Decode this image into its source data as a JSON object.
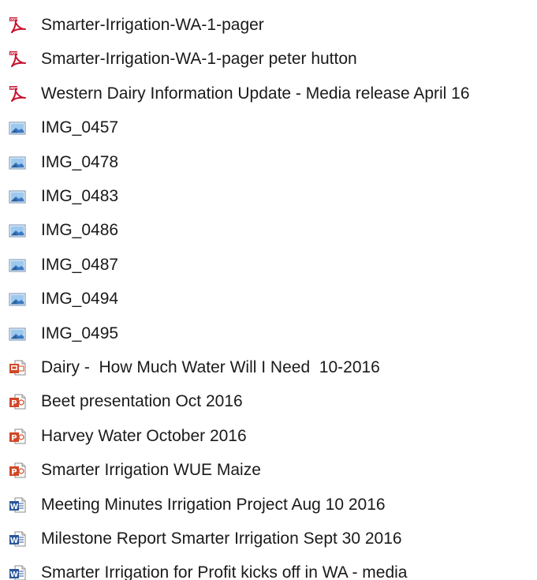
{
  "files": [
    {
      "name": "Smarter-Irrigation-WA-1-pager",
      "type": "pdf",
      "icon": "pdf-file-icon"
    },
    {
      "name": "Smarter-Irrigation-WA-1-pager peter hutton",
      "type": "pdf",
      "icon": "pdf-file-icon"
    },
    {
      "name": "Western Dairy Information Update - Media release April 16",
      "type": "pdf",
      "icon": "pdf-file-icon"
    },
    {
      "name": "IMG_0457",
      "type": "image",
      "icon": "image-file-icon"
    },
    {
      "name": "IMG_0478",
      "type": "image",
      "icon": "image-file-icon"
    },
    {
      "name": "IMG_0483",
      "type": "image",
      "icon": "image-file-icon"
    },
    {
      "name": "IMG_0486",
      "type": "image",
      "icon": "image-file-icon"
    },
    {
      "name": "IMG_0487",
      "type": "image",
      "icon": "image-file-icon"
    },
    {
      "name": "IMG_0494",
      "type": "image",
      "icon": "image-file-icon"
    },
    {
      "name": "IMG_0495",
      "type": "image",
      "icon": "image-file-icon"
    },
    {
      "name": "Dairy -  How Much Water Will I Need  10-2016",
      "type": "pps",
      "icon": "powerpoint-show-icon"
    },
    {
      "name": "Beet presentation Oct 2016",
      "type": "ppt",
      "icon": "powerpoint-file-icon"
    },
    {
      "name": "Harvey Water October 2016",
      "type": "ppt",
      "icon": "powerpoint-file-icon"
    },
    {
      "name": "Smarter Irrigation WUE Maize",
      "type": "ppt",
      "icon": "powerpoint-file-icon"
    },
    {
      "name": "Meeting Minutes Irrigation Project Aug 10 2016",
      "type": "word",
      "icon": "word-file-icon"
    },
    {
      "name": "Milestone Report Smarter Irrigation Sept 30 2016",
      "type": "word",
      "icon": "word-file-icon"
    },
    {
      "name": "Smarter Irrigation for Profit kicks off in WA - media",
      "type": "word",
      "icon": "word-file-icon"
    }
  ],
  "colors": {
    "pdf_red": "#c8102e",
    "ppt_orange": "#d24726",
    "word_blue": "#2b579a",
    "image_blue": "#3a78c3",
    "text": "#1a1a1a"
  }
}
